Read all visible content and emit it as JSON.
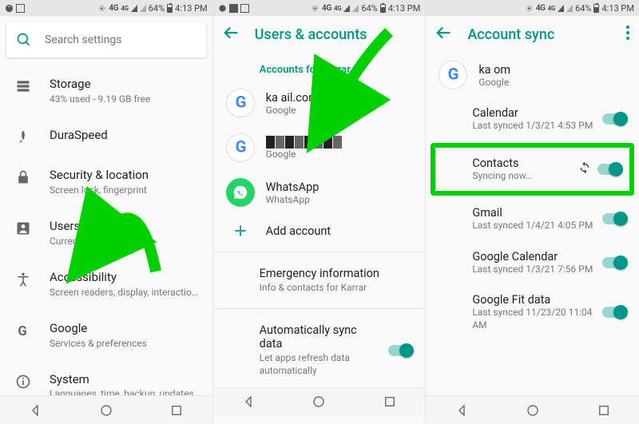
{
  "status": {
    "net": "4G",
    "netSup": "4G",
    "batt": "64%",
    "time": "4:13 PM"
  },
  "p1": {
    "search_ph": "Search settings",
    "items": [
      {
        "t": "Storage",
        "s": "43% used - 9.19 GB free"
      },
      {
        "t": "DuraSpeed",
        "s": ""
      },
      {
        "t": "Security & location",
        "s": "Screen lock, fingerprint"
      },
      {
        "t": "Users & accounts",
        "s": "Current user: Karrar"
      },
      {
        "t": "Accessibility",
        "s": "Screen readers, display, interactio…"
      },
      {
        "t": "Google",
        "s": "Services & preferences"
      },
      {
        "t": "System",
        "s": "Languages, time, backup, updates"
      }
    ]
  },
  "p2": {
    "title": "Users & accounts",
    "section": "Accounts for Karrar",
    "accts": [
      {
        "t": "ka                       ail.com",
        "s": "Google",
        "kind": "google"
      },
      {
        "t": "",
        "s": "Google",
        "kind": "google-obsc"
      },
      {
        "t": "WhatsApp",
        "s": "WhatsApp",
        "kind": "whatsapp"
      }
    ],
    "add": "Add account",
    "emergency": {
      "t": "Emergency information",
      "s": "Info & contacts for Karrar"
    },
    "autosync": {
      "t": "Automatically sync data",
      "s": "Let apps refresh data automatically"
    }
  },
  "p3": {
    "title": "Account sync",
    "acct": {
      "t": "ka                                om",
      "s": "Google"
    },
    "items": [
      {
        "t": "Calendar",
        "s": "Last synced 1/3/21 4:53 PM"
      },
      {
        "t": "Contacts",
        "s": "Syncing now…",
        "spinning": true,
        "hl": true
      },
      {
        "t": "Gmail",
        "s": "Last synced 1/4/21 4:05 PM"
      },
      {
        "t": "Google Calendar",
        "s": "Last synced 1/3/21 7:56 PM"
      },
      {
        "t": "Google Fit data",
        "s": "Last synced 11/23/20 11:04 AM"
      }
    ]
  }
}
